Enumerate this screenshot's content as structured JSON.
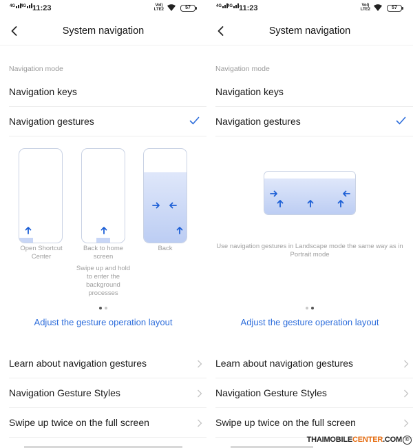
{
  "status": {
    "signal1": "4G",
    "signal2": "4G",
    "time": "11:23",
    "volte": "Vol LTE2",
    "volte_top": "Vol)",
    "volte_bottom": "LTE2",
    "battery": "57"
  },
  "header": {
    "title": "System navigation",
    "back_icon": "chevron-left-icon"
  },
  "navigation_mode": {
    "header": "Navigation mode",
    "options": [
      {
        "label": "Navigation keys",
        "selected": false
      },
      {
        "label": "Navigation gestures",
        "selected": true
      }
    ]
  },
  "carousel_page1": {
    "phones": [
      {
        "caption": "Open Shortcut Center"
      },
      {
        "caption": "Back to home screen",
        "subcaption": "Swipe up and hold to enter the background processes"
      },
      {
        "caption": "Back"
      }
    ],
    "active_dot": 1,
    "dot_count": 2
  },
  "carousel_page2": {
    "caption": "Use navigation gestures in Landscape mode the same way as in Portrait mode",
    "active_dot": 2,
    "dot_count": 2
  },
  "adjust_link": "Adjust the gesture operation layout",
  "menu": [
    {
      "label": "Learn about navigation gestures"
    },
    {
      "label": "Navigation Gesture Styles"
    },
    {
      "label": "Swipe up twice on the full screen"
    }
  ],
  "watermark": {
    "part1": "THAIMOBILE",
    "part2": "CENTER",
    "part3": ".COM",
    "symbol": "©"
  },
  "colors": {
    "accent": "#2d6ddb",
    "gesture_fill": "#bccdf3",
    "watermark_orange": "#e66d12"
  }
}
